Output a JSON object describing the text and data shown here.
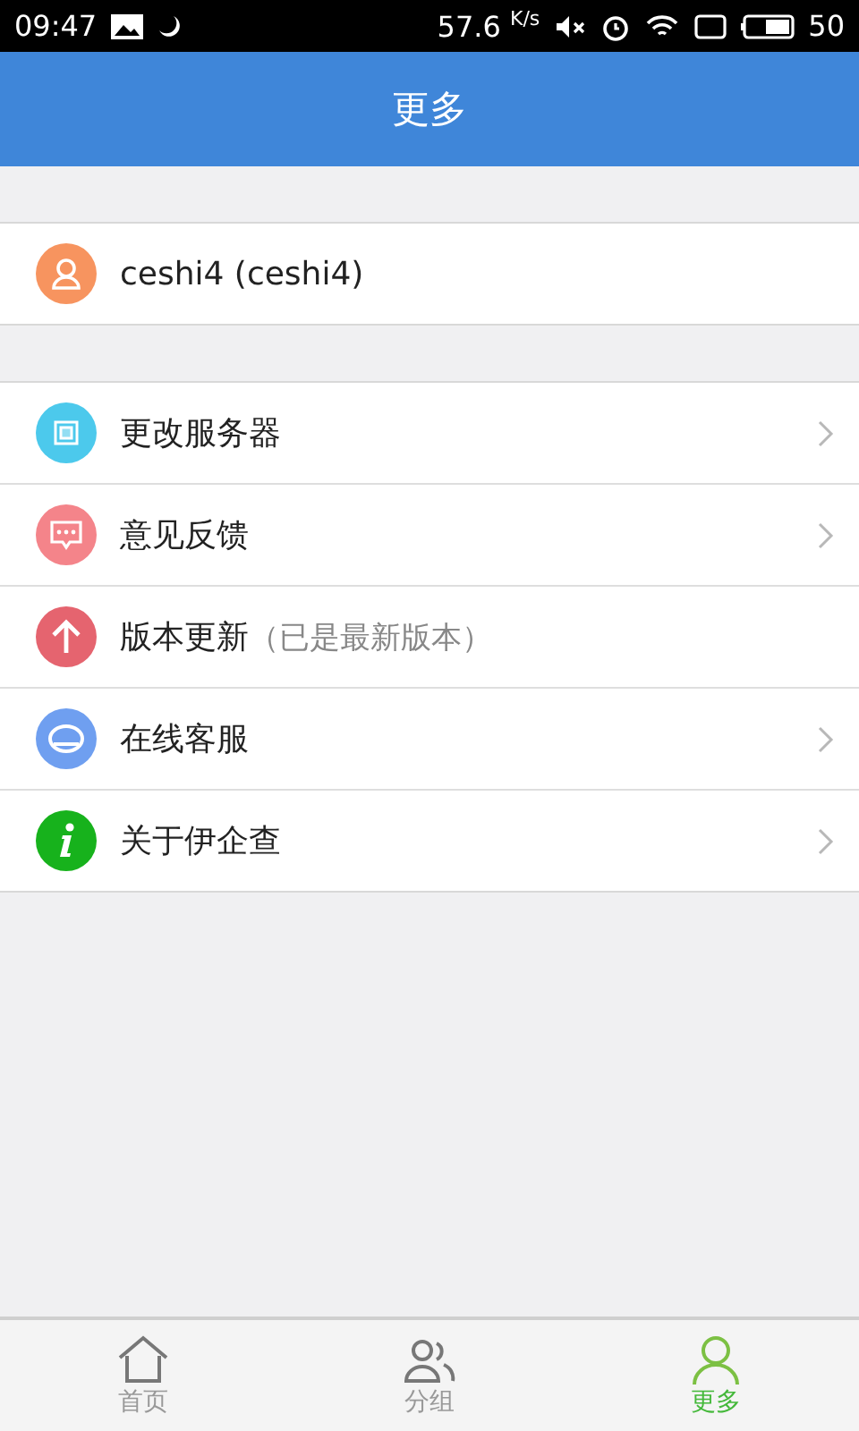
{
  "status_bar": {
    "time": "09:47",
    "speed": "57.6",
    "speed_unit": "K/s",
    "battery": "50"
  },
  "header": {
    "title": "更多"
  },
  "user": {
    "name": "ceshi4 (ceshi4)"
  },
  "menu": [
    {
      "kind": "link",
      "color": "#4cc9ec",
      "label": "更改服务器"
    },
    {
      "kind": "link",
      "color": "#f4848a",
      "label": "意见反馈"
    },
    {
      "kind": "status",
      "color": "#e5646f",
      "label": "版本更新",
      "note": "（已是最新版本）"
    },
    {
      "kind": "link",
      "color": "#6f9ff0",
      "label": "在线客服"
    },
    {
      "kind": "link",
      "color": "#17b21c",
      "label": "关于伊企查"
    }
  ],
  "tabs": [
    {
      "label": "首页",
      "selected": false
    },
    {
      "label": "分组",
      "selected": false
    },
    {
      "label": "更多",
      "selected": true
    }
  ]
}
